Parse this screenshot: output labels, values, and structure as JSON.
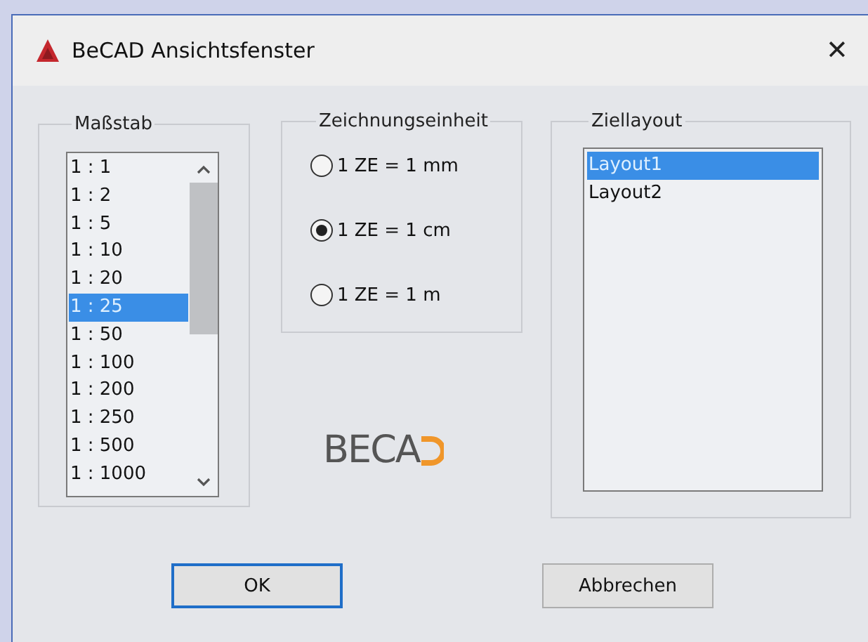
{
  "window": {
    "title": "BeCAD Ansichtsfenster",
    "close": "✕"
  },
  "scale": {
    "label": "Maßstab",
    "items": [
      {
        "label": "1 : 1",
        "selected": false
      },
      {
        "label": "1 : 2",
        "selected": false
      },
      {
        "label": "1 : 5",
        "selected": false
      },
      {
        "label": "1 : 10",
        "selected": false
      },
      {
        "label": "1 : 20",
        "selected": false
      },
      {
        "label": "1 : 25",
        "selected": true
      },
      {
        "label": "1 : 50",
        "selected": false
      },
      {
        "label": "1 : 100",
        "selected": false
      },
      {
        "label": "1 : 200",
        "selected": false
      },
      {
        "label": "1 : 250",
        "selected": false
      },
      {
        "label": "1 : 500",
        "selected": false
      },
      {
        "label": "1 : 1000",
        "selected": false
      }
    ]
  },
  "unit": {
    "label": "Zeichnungseinheit",
    "options": [
      {
        "label": "1 ZE = 1 mm",
        "selected": false
      },
      {
        "label": "1 ZE = 1 cm",
        "selected": true
      },
      {
        "label": "1 ZE = 1 m",
        "selected": false
      }
    ]
  },
  "logo": {
    "text": "BECA"
  },
  "layout": {
    "label": "Ziellayout",
    "items": [
      {
        "label": "Layout1",
        "selected": true
      },
      {
        "label": "Layout2",
        "selected": false
      }
    ]
  },
  "buttons": [
    {
      "label": "OK",
      "default": true
    },
    {
      "label": "Abbrechen",
      "default": false
    }
  ]
}
